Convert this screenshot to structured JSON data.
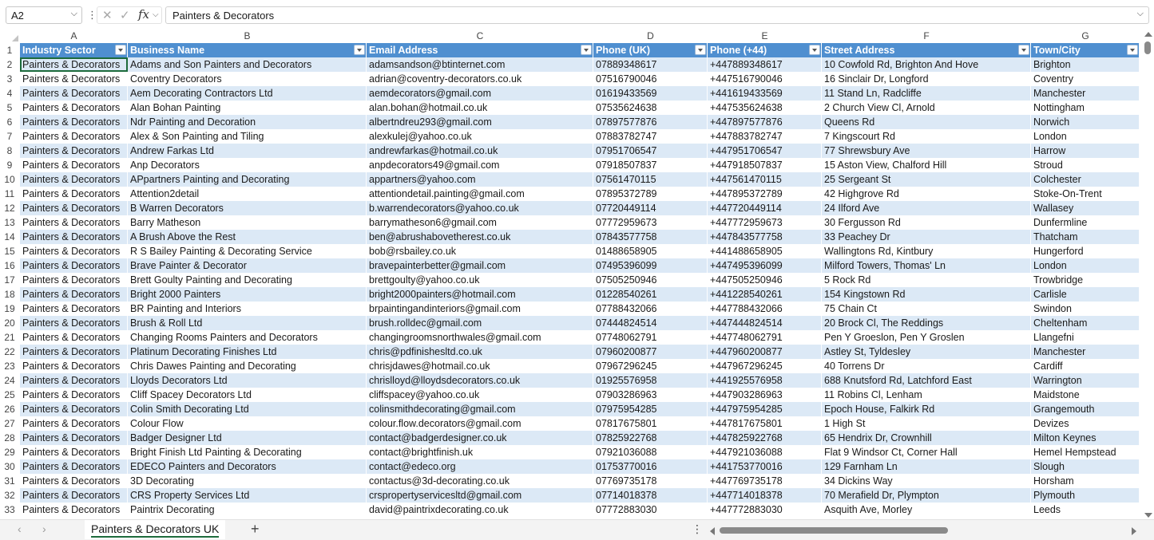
{
  "formula_bar": {
    "name_box": "A2",
    "formula": "Painters & Decorators",
    "cancel_icon": "✕",
    "enter_icon": "✓",
    "fx_label": "fx"
  },
  "columns": [
    "A",
    "B",
    "C",
    "D",
    "E",
    "F",
    "G"
  ],
  "header_row": {
    "row_number": "1",
    "cells": [
      "Industry Sector",
      "Business Name",
      "Email Address",
      "Phone (UK)",
      "Phone (+44)",
      "Street Address",
      "Town/City"
    ]
  },
  "rows": [
    {
      "n": "2",
      "cells": [
        "Painters & Decorators",
        "Adams and Son Painters and Decorators",
        "adamsandson@btinternet.com",
        "07889348617",
        "+447889348617",
        "10 Cowfold Rd, Brighton And Hove",
        "Brighton"
      ]
    },
    {
      "n": "3",
      "cells": [
        "Painters & Decorators",
        "Coventry Decorators",
        "adrian@coventry-decorators.co.uk",
        "07516790046",
        "+447516790046",
        "16 Sinclair Dr, Longford",
        "Coventry"
      ]
    },
    {
      "n": "4",
      "cells": [
        "Painters & Decorators",
        "Aem Decorating Contractors Ltd",
        "aemdecorators@gmail.com",
        "01619433569",
        "+441619433569",
        "11 Stand Ln, Radcliffe",
        "Manchester"
      ]
    },
    {
      "n": "5",
      "cells": [
        "Painters & Decorators",
        "Alan Bohan Painting",
        "alan.bohan@hotmail.co.uk",
        "07535624638",
        "+447535624638",
        "2 Church View Cl, Arnold",
        "Nottingham"
      ]
    },
    {
      "n": "6",
      "cells": [
        "Painters & Decorators",
        "Ndr Painting and Decoration",
        "albertndreu293@gmail.com",
        "07897577876",
        "+447897577876",
        "Queens Rd",
        "Norwich"
      ]
    },
    {
      "n": "7",
      "cells": [
        "Painters & Decorators",
        "Alex & Son Painting and Tiling",
        "alexkulej@yahoo.co.uk",
        "07883782747",
        "+447883782747",
        "7 Kingscourt Rd",
        "London"
      ]
    },
    {
      "n": "8",
      "cells": [
        "Painters & Decorators",
        "Andrew Farkas Ltd",
        "andrewfarkas@hotmail.co.uk",
        "07951706547",
        "+447951706547",
        "77 Shrewsbury Ave",
        "Harrow"
      ]
    },
    {
      "n": "9",
      "cells": [
        "Painters & Decorators",
        "Anp Decorators",
        "anpdecorators49@gmail.com",
        "07918507837",
        "+447918507837",
        "15 Aston View, Chalford Hill",
        "Stroud"
      ]
    },
    {
      "n": "10",
      "cells": [
        "Painters & Decorators",
        "APpartners Painting and Decorating",
        "appartners@yahoo.com",
        "07561470115",
        "+447561470115",
        "25 Sergeant St",
        "Colchester"
      ]
    },
    {
      "n": "11",
      "cells": [
        "Painters & Decorators",
        "Attention2detail",
        "attentiondetail.painting@gmail.com",
        "07895372789",
        "+447895372789",
        "42 Highgrove Rd",
        "Stoke-On-Trent"
      ]
    },
    {
      "n": "12",
      "cells": [
        "Painters & Decorators",
        "B Warren Decorators",
        "b.warrendecorators@yahoo.co.uk",
        "07720449114",
        "+447720449114",
        "24 Ilford Ave",
        "Wallasey"
      ]
    },
    {
      "n": "13",
      "cells": [
        "Painters & Decorators",
        "Barry Matheson",
        "barrymatheson6@gmail.com",
        "07772959673",
        "+447772959673",
        "30 Fergusson Rd",
        "Dunfermline"
      ]
    },
    {
      "n": "14",
      "cells": [
        "Painters & Decorators",
        "A Brush Above the Rest",
        "ben@abrushabovetherest.co.uk",
        "07843577758",
        "+447843577758",
        "33 Peachey Dr",
        "Thatcham"
      ]
    },
    {
      "n": "15",
      "cells": [
        "Painters & Decorators",
        "R S Bailey Painting & Decorating Service",
        "bob@rsbailey.co.uk",
        "01488658905",
        "+441488658905",
        "Wallingtons Rd, Kintbury",
        "Hungerford"
      ]
    },
    {
      "n": "16",
      "cells": [
        "Painters & Decorators",
        "Brave Painter & Decorator",
        "bravepainterbetter@gmail.com",
        "07495396099",
        "+447495396099",
        "Milford Towers, Thomas' Ln",
        "London"
      ]
    },
    {
      "n": "17",
      "cells": [
        "Painters & Decorators",
        "Brett Goulty Painting and Decorating",
        "brettgoulty@yahoo.co.uk",
        "07505250946",
        "+447505250946",
        "5 Rock Rd",
        "Trowbridge"
      ]
    },
    {
      "n": "18",
      "cells": [
        "Painters & Decorators",
        "Bright 2000 Painters",
        "bright2000painters@hotmail.com",
        "01228540261",
        "+441228540261",
        "154 Kingstown Rd",
        "Carlisle"
      ]
    },
    {
      "n": "19",
      "cells": [
        "Painters & Decorators",
        "BR Painting and Interiors",
        "brpaintingandinteriors@gmail.com",
        "07788432066",
        "+447788432066",
        "75 Chain Ct",
        "Swindon"
      ]
    },
    {
      "n": "20",
      "cells": [
        "Painters & Decorators",
        "Brush & Roll Ltd",
        "brush.rolldec@gmail.com",
        "07444824514",
        "+447444824514",
        "20 Brock Cl, The Reddings",
        "Cheltenham"
      ]
    },
    {
      "n": "21",
      "cells": [
        "Painters & Decorators",
        "Changing Rooms Painters and Decorators",
        "changingroomsnorthwales@gmail.com",
        "07748062791",
        "+447748062791",
        "Pen Y Groeslon, Pen Y Groslen",
        "Llangefni"
      ]
    },
    {
      "n": "22",
      "cells": [
        "Painters & Decorators",
        "Platinum Decorating Finishes Ltd",
        "chris@pdfinishesltd.co.uk",
        "07960200877",
        "+447960200877",
        "Astley St, Tyldesley",
        "Manchester"
      ]
    },
    {
      "n": "23",
      "cells": [
        "Painters & Decorators",
        "Chris Dawes Painting and Decorating",
        "chrisjdawes@hotmail.co.uk",
        "07967296245",
        "+447967296245",
        "40 Torrens Dr",
        "Cardiff"
      ]
    },
    {
      "n": "24",
      "cells": [
        "Painters & Decorators",
        "Lloyds Decorators Ltd",
        "chrislloyd@lloydsdecorators.co.uk",
        "01925576958",
        "+441925576958",
        "688 Knutsford Rd, Latchford East",
        "Warrington"
      ]
    },
    {
      "n": "25",
      "cells": [
        "Painters & Decorators",
        "Cliff Spacey Decorators Ltd",
        "cliffspacey@yahoo.co.uk",
        "07903286963",
        "+447903286963",
        "11 Robins Cl, Lenham",
        "Maidstone"
      ]
    },
    {
      "n": "26",
      "cells": [
        "Painters & Decorators",
        "Colin Smith Decorating Ltd",
        "colinsmithdecorating@gmail.com",
        "07975954285",
        "+447975954285",
        "Epoch House, Falkirk Rd",
        "Grangemouth"
      ]
    },
    {
      "n": "27",
      "cells": [
        "Painters & Decorators",
        "Colour Flow",
        "colour.flow.decorators@gmail.com",
        "07817675801",
        "+447817675801",
        "1 High St",
        "Devizes"
      ]
    },
    {
      "n": "28",
      "cells": [
        "Painters & Decorators",
        "Badger Designer Ltd",
        "contact@badgerdesigner.co.uk",
        "07825922768",
        "+447825922768",
        "65 Hendrix Dr, Crownhill",
        "Milton Keynes"
      ]
    },
    {
      "n": "29",
      "cells": [
        "Painters & Decorators",
        "Bright Finish Ltd Painting & Decorating",
        "contact@brightfinish.uk",
        "07921036088",
        "+447921036088",
        "Flat 9 Windsor Ct, Corner Hall",
        "Hemel Hempstead"
      ]
    },
    {
      "n": "30",
      "cells": [
        "Painters & Decorators",
        "EDECO Painters and Decorators",
        "contact@edeco.org",
        "01753770016",
        "+441753770016",
        "129 Farnham Ln",
        "Slough"
      ]
    },
    {
      "n": "31",
      "cells": [
        "Painters & Decorators",
        "3D Decorating",
        "contactus@3d-decorating.co.uk",
        "07769735178",
        "+447769735178",
        "34 Dickins Way",
        "Horsham"
      ]
    },
    {
      "n": "32",
      "cells": [
        "Painters & Decorators",
        "CRS Property Services Ltd",
        "crspropertyservicesltd@gmail.com",
        "07714018378",
        "+447714018378",
        "70 Merafield Dr, Plympton",
        "Plymouth"
      ]
    },
    {
      "n": "33",
      "cells": [
        "Painters & Decorators",
        "Paintrix Decorating",
        "david@paintrixdecorating.co.uk",
        "07772883030",
        "+447772883030",
        "Asquith Ave, Morley",
        "Leeds"
      ]
    }
  ],
  "sheet_tabs": [
    "Painters & Decorators UK"
  ],
  "tab_bar": {
    "prev_icon": "‹",
    "next_icon": "›",
    "add_icon": "+",
    "more_icon": "⋮"
  },
  "colors": {
    "header_fill": "#4f8fd0",
    "band_fill": "#dce9f6",
    "active_tab_accent": "#1d6b3c"
  }
}
